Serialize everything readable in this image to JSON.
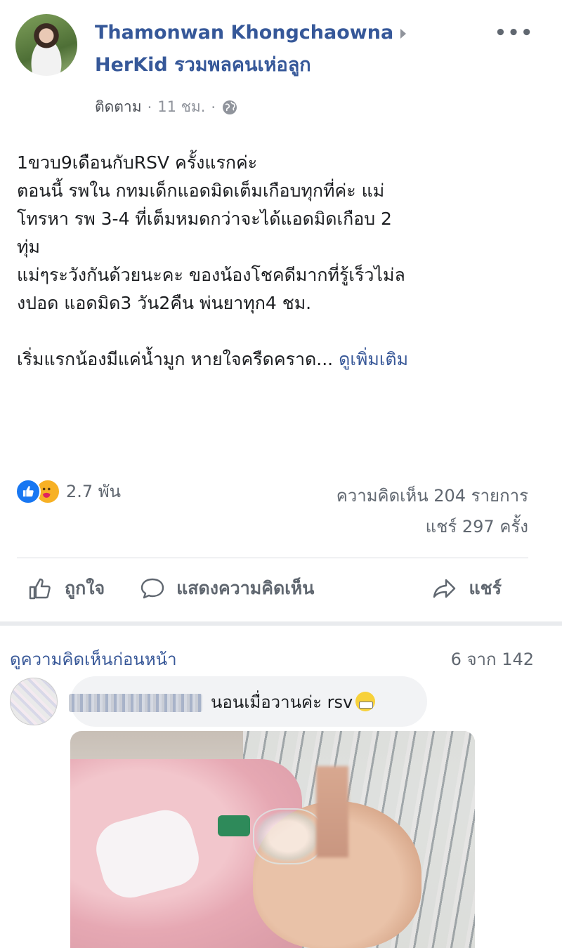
{
  "post": {
    "author_line1": "Thamonwan Khongchaowna",
    "author_line2": "HerKid รวมพลคนเห่อลูก",
    "more_label": "•••",
    "follow_label": "ติดตาม",
    "separator": "·",
    "time": "11 ชม.",
    "separator2": "·",
    "privacy_icon": "globe-icon",
    "body_lines": [
      "1ขวบ9เดือนกับRSV ครั้งแรกค่ะ",
      "ตอนนี้ รพใน กทมเด็กแอดมิดเต็มเกือบทุกที่ค่ะ แม่",
      "โทรหา รพ 3-4 ที่เต็มหมดกว่าจะได้แอดมิดเกือบ 2",
      "ทุ่ม",
      "แม่ๆระวังกันด้วยนะคะ ของน้องโชคดีมากที่รู้เร็วไม่ล",
      "งปอด แอดมิด3 วัน2คืน พ่นยาทุก4 ชม."
    ],
    "body_last": "เริ่มแรกน้องมีแค่น้ำมูก หายใจครืดคราด...",
    "see_more": "ดูเพิ่มเติม",
    "reaction_count": "2.7 พัน",
    "comments_count": "ความคิดเห็น 204 รายการ",
    "shares_count": "แชร์ 297 ครั้ง",
    "actions": {
      "like": "ถูกใจ",
      "comment": "แสดงความคิดเห็น",
      "share": "แชร์"
    }
  },
  "comments": {
    "previous_link": "ดูความคิดเห็นก่อนหน้า",
    "pager": "6 จาก 142",
    "first": {
      "text": "นอนเมื่อวานค่ะ rsv",
      "emoji": "grinning-face-with-mask-emoji"
    }
  },
  "colors": {
    "link_blue": "#365899",
    "like_blue": "#1877f2",
    "care_yellow": "#f7b125",
    "muted_gray": "#606770"
  }
}
